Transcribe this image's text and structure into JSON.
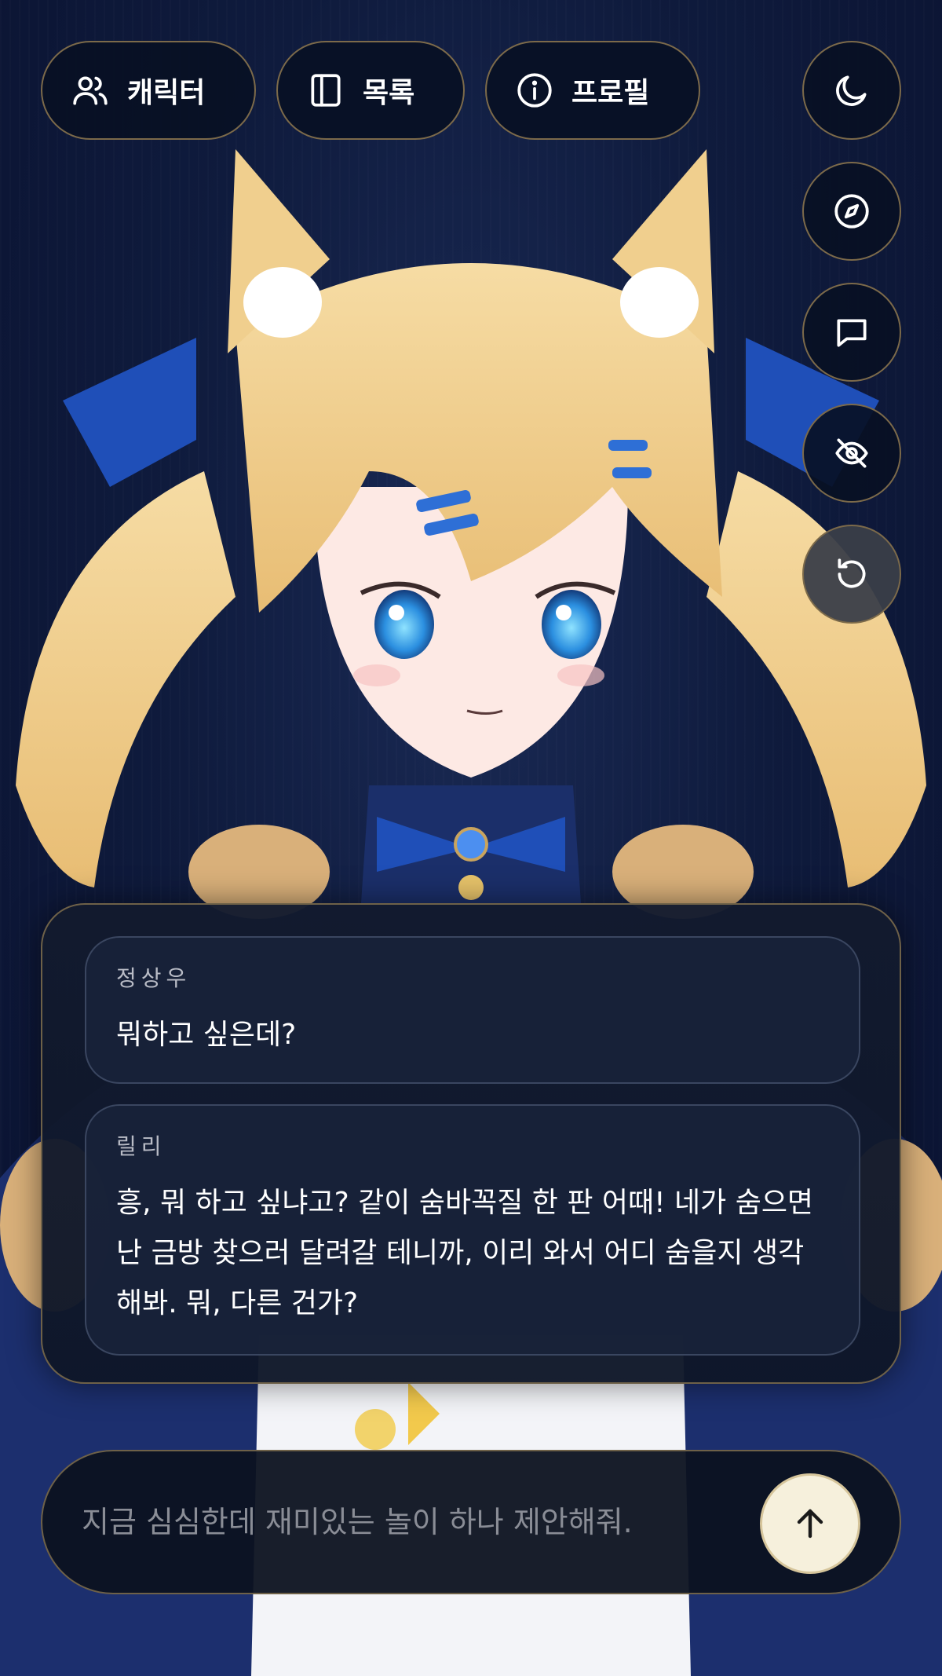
{
  "header": {
    "characters_label": "캐릭터",
    "list_label": "목록",
    "profile_label": "프로필"
  },
  "side_buttons": [
    {
      "icon": "moon-icon"
    },
    {
      "icon": "compass-icon"
    },
    {
      "icon": "message-icon"
    },
    {
      "icon": "eye-off-icon"
    },
    {
      "icon": "refresh-icon"
    }
  ],
  "chat": {
    "messages": [
      {
        "speaker": "정상우",
        "text": "뭐하고 싶은데?"
      },
      {
        "speaker": "릴리",
        "text": "흥, 뭐 하고 싶냐고? 같이 숨바꼭질 한 판 어때! 네가 숨으면 난 금방 찾으러 달려갈 테니까, 이리 와서 어디 숨을지 생각해봐. 뭐, 다른 건가?"
      }
    ]
  },
  "input": {
    "placeholder": "지금 심심한데 재미있는 놀이 하나 제안해줘."
  },
  "colors": {
    "background": "#0b1530",
    "border_gold": "#7c6a4a",
    "send_button": "#f6f0dc",
    "hair": "#f0cf8e",
    "ribbon": "#1f4fb8"
  }
}
